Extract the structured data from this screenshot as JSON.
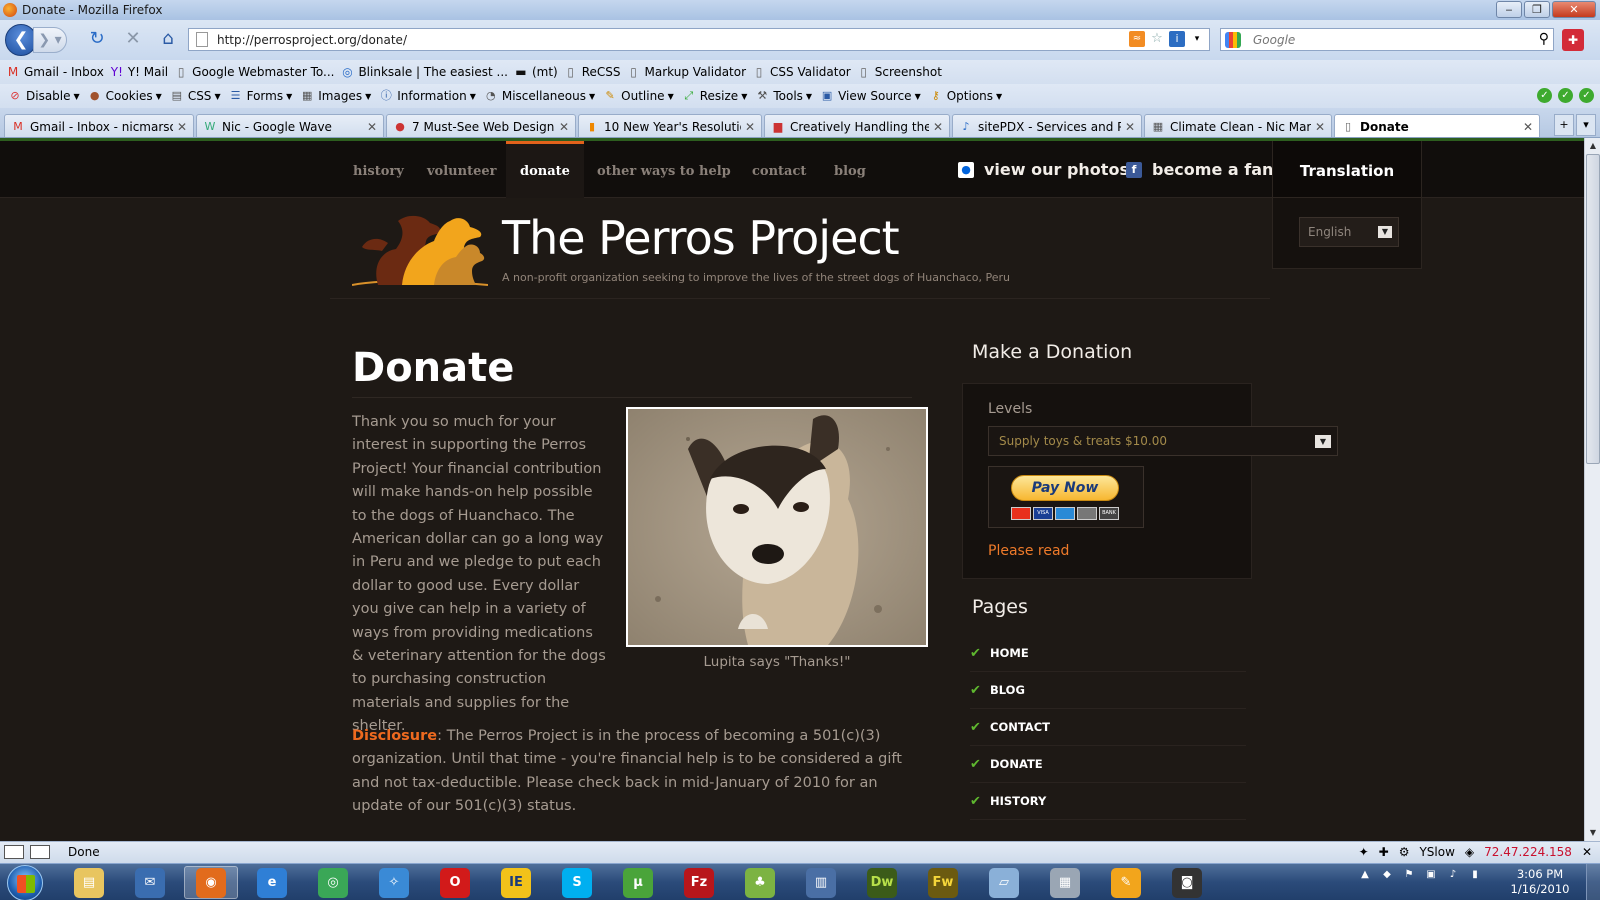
{
  "window": {
    "title": "Donate - Mozilla Firefox"
  },
  "nav": {
    "url": "http://perrosproject.org/donate/",
    "search_placeholder": "Google"
  },
  "bookmarks": [
    {
      "label": "Gmail - Inbox",
      "icon": "gmail-icon"
    },
    {
      "label": "Y! Mail",
      "icon": "yahoo-icon"
    },
    {
      "label": "Google Webmaster To...",
      "icon": "page-icon"
    },
    {
      "label": "Blinksale | The easiest ...",
      "icon": "blinksale-icon"
    },
    {
      "label": "(mt)",
      "icon": "mt-icon"
    },
    {
      "label": "ReCSS",
      "icon": "page-icon"
    },
    {
      "label": "Markup Validator",
      "icon": "page-icon"
    },
    {
      "label": "CSS Validator",
      "icon": "page-icon"
    },
    {
      "label": "Screenshot",
      "icon": "page-icon"
    }
  ],
  "webdev": [
    {
      "label": "Disable",
      "icon": "disable-icon"
    },
    {
      "label": "Cookies",
      "icon": "cookies-icon"
    },
    {
      "label": "CSS",
      "icon": "css-icon"
    },
    {
      "label": "Forms",
      "icon": "forms-icon"
    },
    {
      "label": "Images",
      "icon": "images-icon"
    },
    {
      "label": "Information",
      "icon": "information-icon"
    },
    {
      "label": "Miscellaneous",
      "icon": "misc-icon"
    },
    {
      "label": "Outline",
      "icon": "outline-icon"
    },
    {
      "label": "Resize",
      "icon": "resize-icon"
    },
    {
      "label": "Tools",
      "icon": "tools-icon"
    },
    {
      "label": "View Source",
      "icon": "view-source-icon"
    },
    {
      "label": "Options",
      "icon": "options-icon"
    }
  ],
  "tabs": [
    {
      "label": "Gmail - Inbox - nicmarso..."
    },
    {
      "label": "Nic - Google Wave"
    },
    {
      "label": "7 Must-See Web Design ..."
    },
    {
      "label": "10 New Year's Resolution..."
    },
    {
      "label": "Creatively Handling the ..."
    },
    {
      "label": "sitePDX - Services and Pr..."
    },
    {
      "label": "Climate Clean - Nic Mars..."
    },
    {
      "label": "Donate"
    }
  ],
  "site": {
    "nav": [
      "history",
      "volunteer",
      "donate",
      "other ways to help",
      "contact",
      "blog"
    ],
    "photos_link": "view our photos",
    "fan_link": "become a fan",
    "translation": {
      "heading": "Translation",
      "selected": "English"
    },
    "title": "The Perros Project",
    "tagline": "A non-profit organization seeking to improve the lives of the street dogs of Huanchaco, Peru"
  },
  "main": {
    "heading": "Donate",
    "intro": "Thank you so much for your interest in supporting the Perros Project! Your financial contribution will make hands-on help possible to the dogs of Huanchaco. The American dollar can go a long way in Peru and we pledge to put each dollar to good use. Every dollar you give can help in a variety of ways from providing medications & veterinary attention for the dogs to purchasing construction materials and supplies for the shelter.",
    "caption": "Lupita says \"Thanks!\"",
    "disclosure_label": "Disclosure",
    "disclosure_text": ": The Perros Project is in the process of becoming a 501(c)(3) organization. Until that time - you're financial help is to be considered a gift and not tax-deductible. Please check back in mid-January of 2010 for an update of our 501(c)(3) status."
  },
  "sidebar": {
    "donation_heading": "Make a Donation",
    "levels_label": "Levels",
    "level_selected": "Supply toys & treats $10.00",
    "pay_now": "Pay Now",
    "card_labels": [
      "VISA",
      "BANK"
    ],
    "please_read": "Please read",
    "pages_heading": "Pages",
    "pages": [
      "HOME",
      "BLOG",
      "CONTACT",
      "DONATE",
      "HISTORY"
    ]
  },
  "status": {
    "text": "Done",
    "yslow": "YSlow",
    "ip": "72.47.224.158"
  },
  "taskbar": {
    "apps": [
      {
        "name": "explorer",
        "label": ""
      },
      {
        "name": "thunderbird",
        "label": ""
      },
      {
        "name": "firefox",
        "label": ""
      },
      {
        "name": "ie",
        "label": ""
      },
      {
        "name": "chrome",
        "label": ""
      },
      {
        "name": "safari",
        "label": ""
      },
      {
        "name": "opera",
        "label": ""
      },
      {
        "name": "ietester",
        "label": "IE"
      },
      {
        "name": "skype",
        "label": "S"
      },
      {
        "name": "utorrent",
        "label": "µ"
      },
      {
        "name": "filezilla",
        "label": "Fz"
      },
      {
        "name": "evernote",
        "label": ""
      },
      {
        "name": "windows",
        "label": ""
      },
      {
        "name": "dreamweaver",
        "label": "Dw"
      },
      {
        "name": "fireworks",
        "label": "Fw"
      },
      {
        "name": "journal",
        "label": ""
      },
      {
        "name": "calculator",
        "label": ""
      },
      {
        "name": "paint",
        "label": ""
      },
      {
        "name": "camera",
        "label": ""
      }
    ],
    "time": "3:06 PM",
    "date": "1/16/2010"
  }
}
